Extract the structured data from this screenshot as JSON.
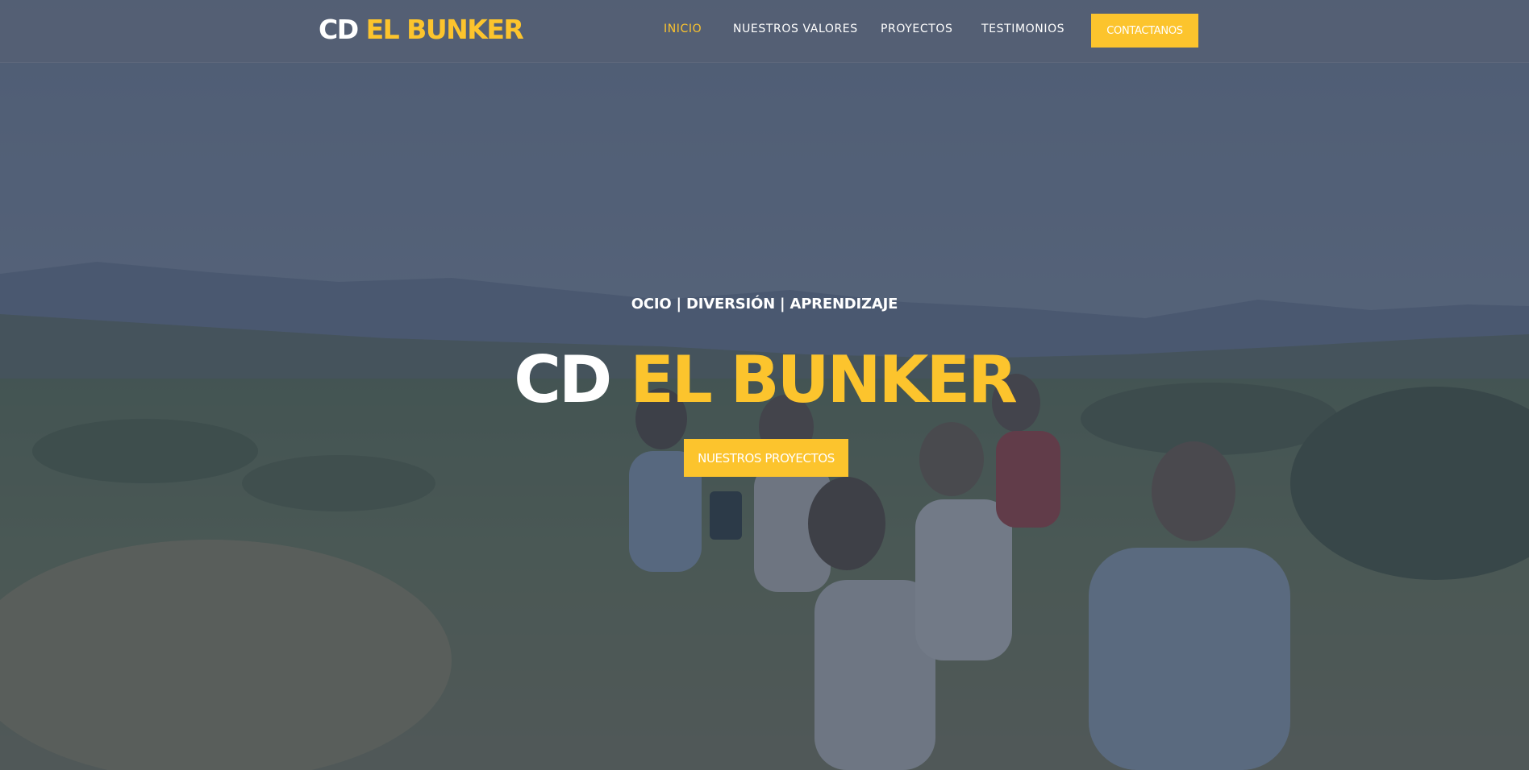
{
  "brand": {
    "prefix": "CD",
    "name": "EL BUNKER"
  },
  "nav": {
    "items": [
      {
        "label": "INICIO",
        "active": true
      },
      {
        "label": "NUESTROS VALORES",
        "active": false
      },
      {
        "label": "PROYECTOS",
        "active": false
      },
      {
        "label": "TESTIMONIOS",
        "active": false
      }
    ],
    "contact_label": "CONTACTANOS"
  },
  "hero": {
    "tagline": "OCIO | DIVERSIÓN | APRENDIZAJE",
    "title_prefix": "CD",
    "title_name": "EL BUNKER",
    "cta_label": "NUESTROS PROYECTOS",
    "background": "photo of children sitting on a hillside with mountains behind"
  },
  "colors": {
    "accent": "#fcc42d",
    "header_bg": "#546074",
    "overlay": "#2c3a52",
    "text": "#ffffff"
  }
}
